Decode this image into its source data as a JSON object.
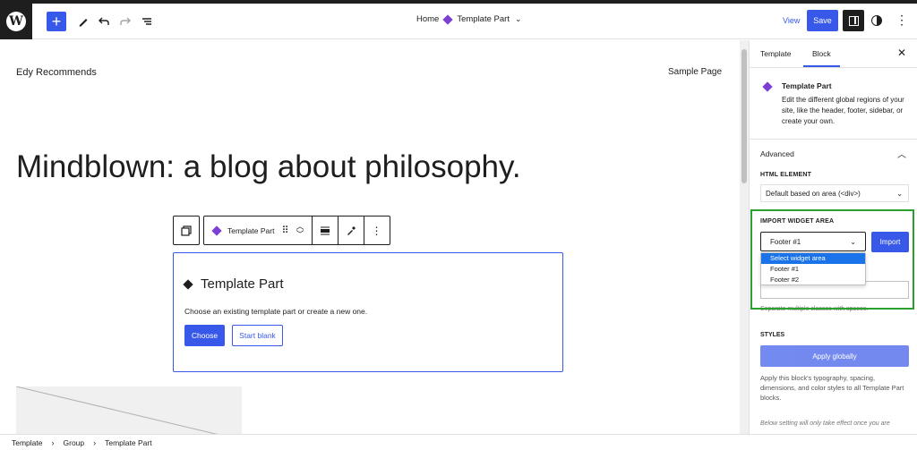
{
  "topbar": {
    "add_icon": "plus-icon",
    "edit_icon": "pencil-icon",
    "undo_icon": "undo-icon",
    "redo_icon": "redo-icon",
    "list_icon": "list-view-icon",
    "breadcrumb_home": "Home",
    "breadcrumb_current": "Template Part",
    "view_label": "View",
    "save_label": "Save"
  },
  "canvas": {
    "site_title": "Edy Recommends",
    "nav_link": "Sample Page",
    "headline": "Mindblown: a blog about philosophy."
  },
  "block_toolbar": {
    "label": "Template Part"
  },
  "template_part_block": {
    "title": "Template Part",
    "description": "Choose an existing template part or create a new one.",
    "choose_label": "Choose",
    "start_blank_label": "Start blank"
  },
  "sidebar": {
    "tabs": [
      {
        "label": "Template"
      },
      {
        "label": "Block"
      }
    ],
    "close_icon": "close-icon",
    "card_title": "Template Part",
    "card_description": "Edit the different global regions of your site, like the header, footer, sidebar, or create your own.",
    "advanced_label": "Advanced",
    "html_element_label": "HTML ELEMENT",
    "html_element_value": "Default based on area (<div>)",
    "import_widget_label": "IMPORT WIDGET AREA",
    "import_widget_value": "Footer #1",
    "import_button": "Import",
    "dropdown_options": [
      "Select widget area",
      "Footer #1",
      "Footer #2"
    ],
    "css_help": "Separate multiple classes with spaces.",
    "styles_label": "STYLES",
    "apply_globally": "Apply globally",
    "apply_description": "Apply this block's typography, spacing, dimensions, and color styles to all Template Part blocks.",
    "below_note": "Below setting will only take effect once you are"
  },
  "footer": {
    "crumbs": [
      "Template",
      "Group",
      "Template Part"
    ]
  },
  "colors": {
    "accent": "#3858e9",
    "template_part_purple": "#7b3fd3",
    "highlight_green": "#2ca02c"
  }
}
